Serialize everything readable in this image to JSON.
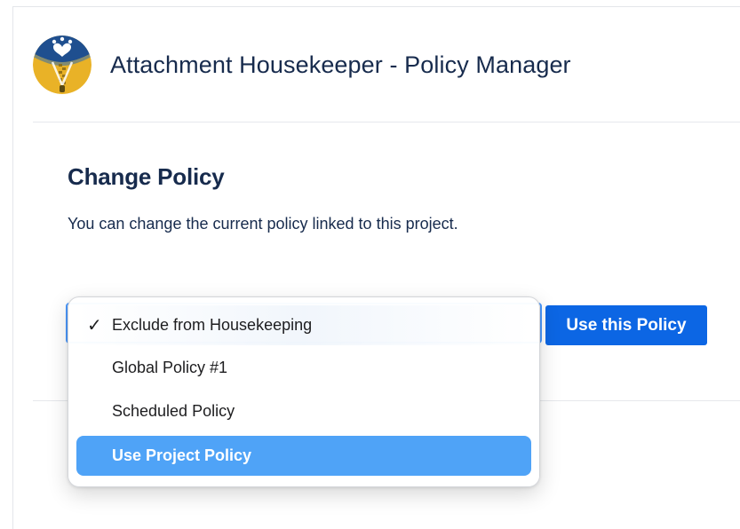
{
  "header": {
    "title": "Attachment Housekeeper - Policy Manager",
    "logo_icon": "zipper-heart-logo-icon",
    "logo_colors": {
      "top": "#1f4f8f",
      "bottom": "#e9b227",
      "heart": "#ffffff"
    }
  },
  "section": {
    "title": "Change Policy",
    "description": "You can change the current policy linked to this project."
  },
  "policy_select": {
    "selected": "Exclude from Housekeeping",
    "options": [
      {
        "label": "Exclude from Housekeeping",
        "checked": true,
        "highlighted": false
      },
      {
        "label": "Global Policy #1",
        "checked": false,
        "highlighted": false
      },
      {
        "label": "Scheduled Policy",
        "checked": false,
        "highlighted": false
      },
      {
        "label": "Use Project Policy",
        "checked": false,
        "highlighted": true
      }
    ],
    "check_glyph": "✓"
  },
  "actions": {
    "apply_label": "Use this Policy"
  },
  "colors": {
    "primary_button": "#0c66e4",
    "highlight": "#4fa3f7",
    "text": "#172b4d",
    "focus_border": "#4c9aff"
  }
}
